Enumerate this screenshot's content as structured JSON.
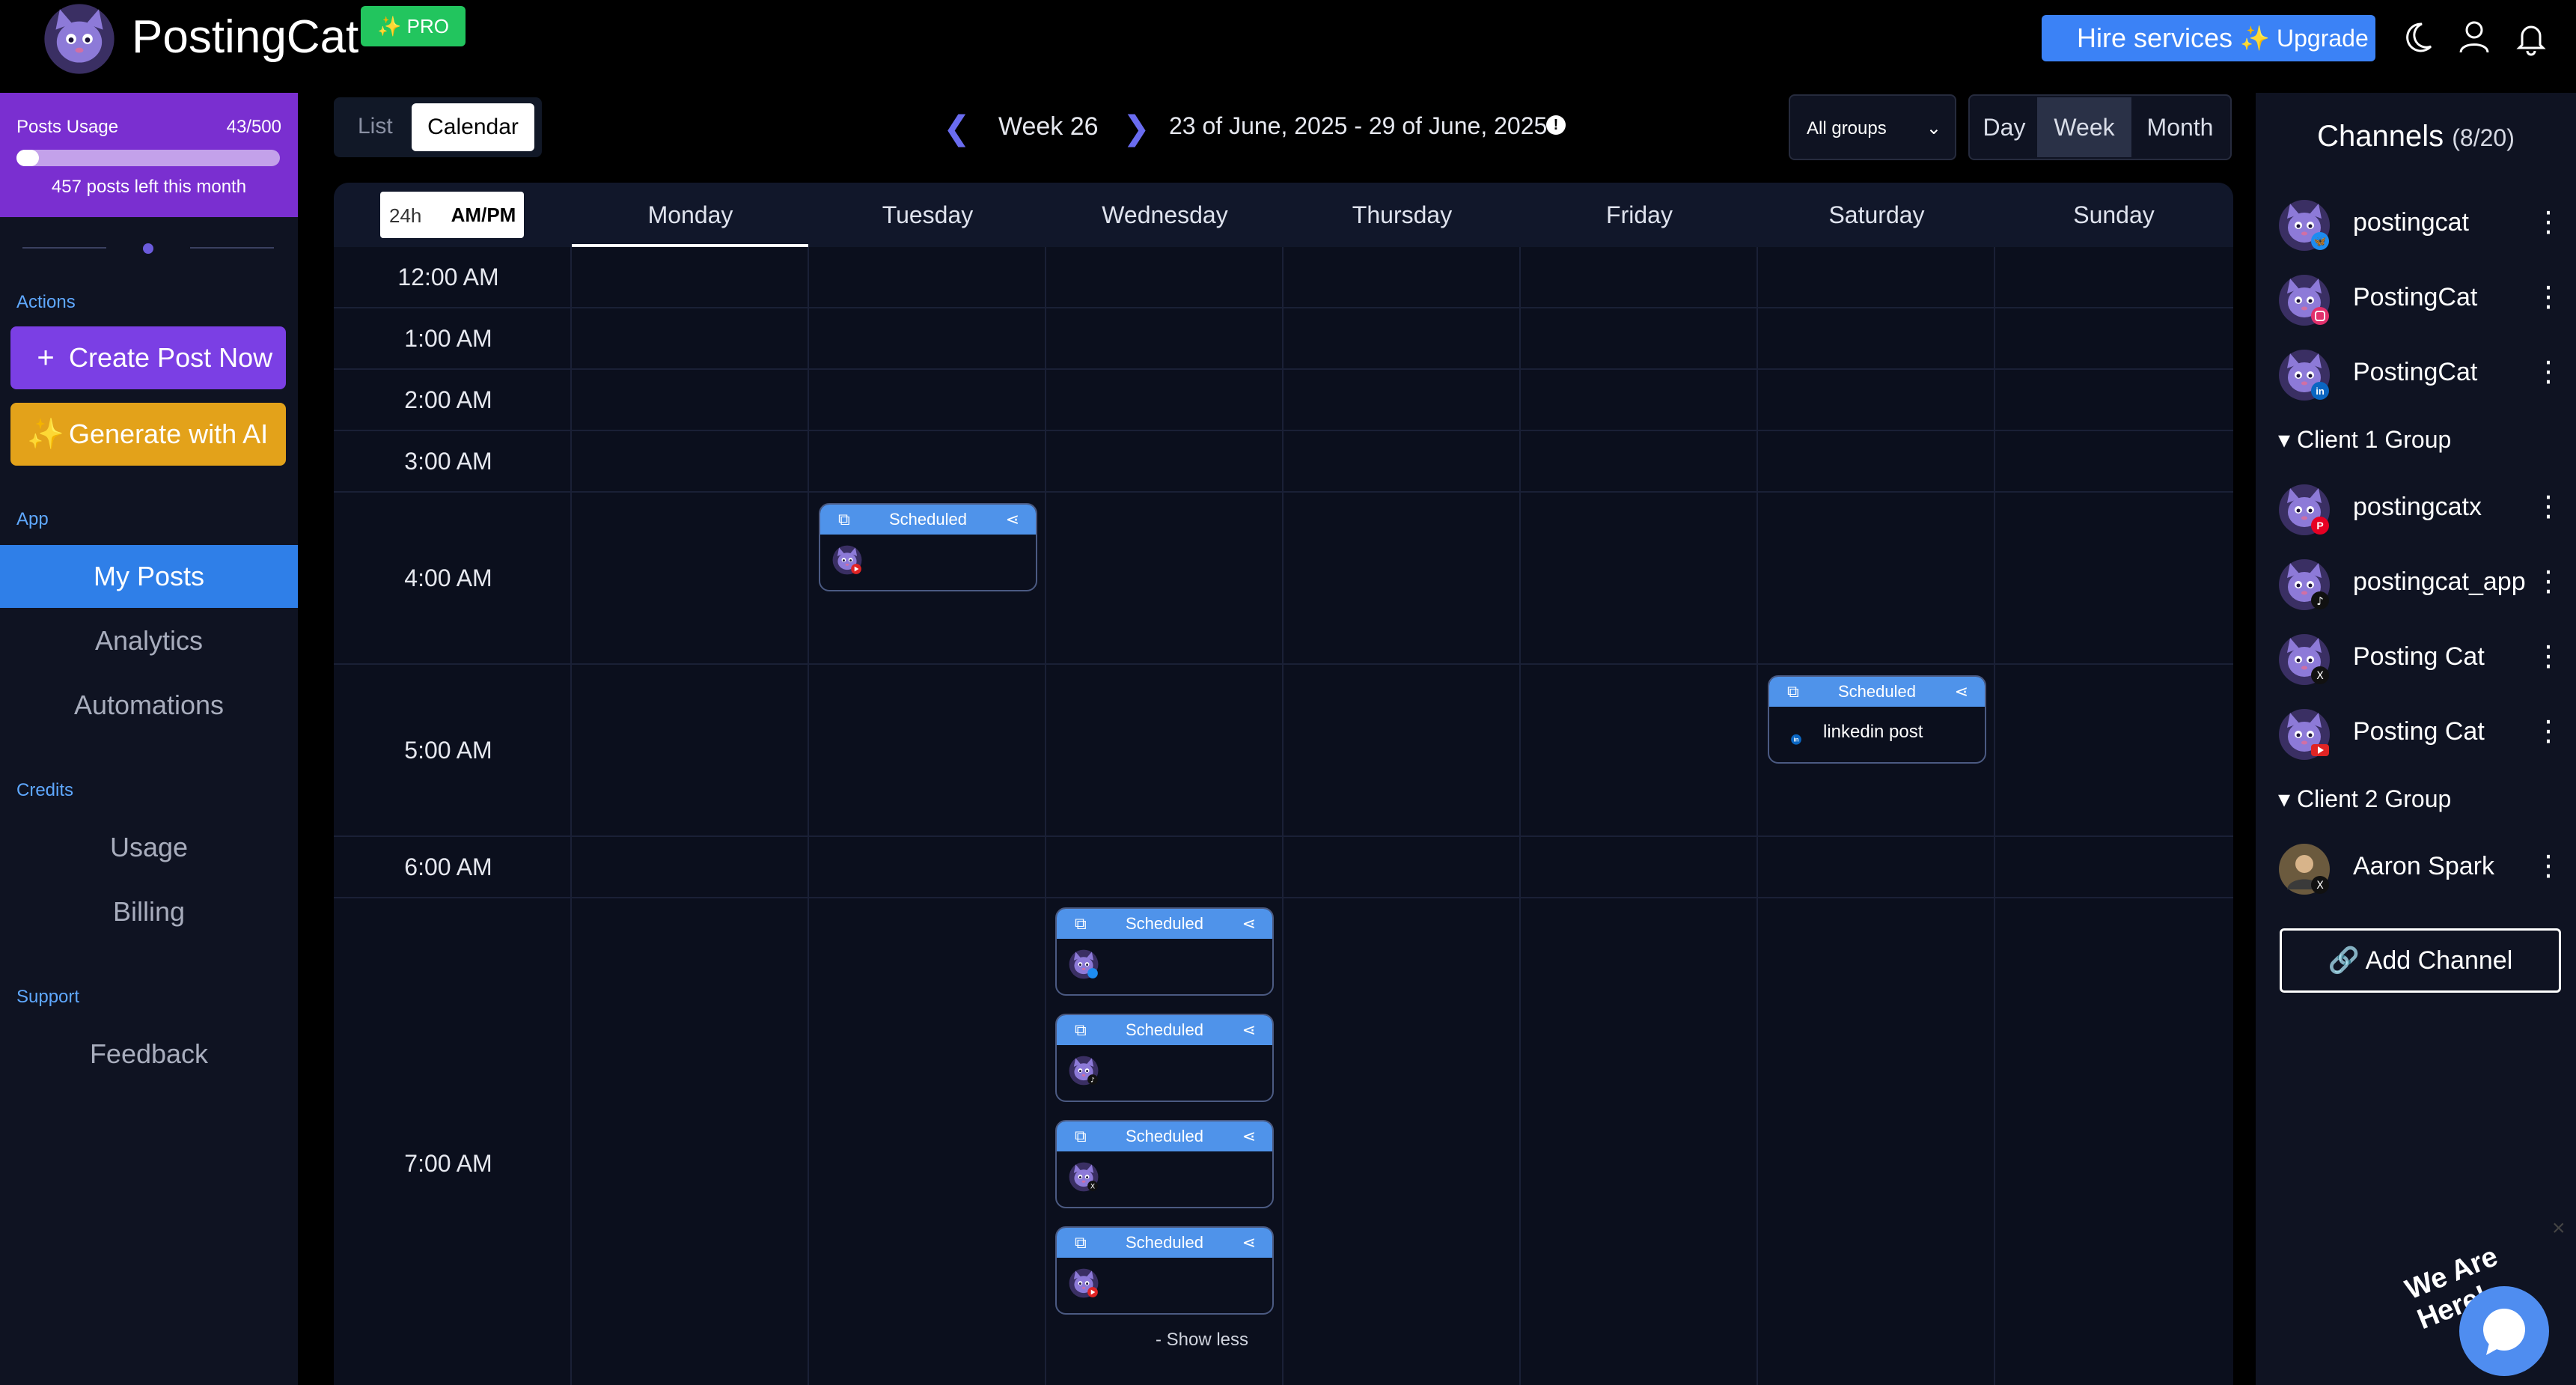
{
  "app": {
    "name": "PostingCat",
    "badge": "✨ PRO"
  },
  "header": {
    "hire_label": "Hire services",
    "upgrade_label": "✨ Upgrade"
  },
  "usage": {
    "title": "Posts Usage",
    "count": "43/500",
    "fraction": 0.086,
    "left_text": "457 posts left this month"
  },
  "sidebar": {
    "actions_label": "Actions",
    "create_label": "Create Post Now",
    "generate_label": "Generate with AI",
    "app_label": "App",
    "app_items": [
      "My Posts",
      "Analytics",
      "Automations"
    ],
    "credits_label": "Credits",
    "credit_items": [
      "Usage",
      "Billing"
    ],
    "support_label": "Support",
    "support_items": [
      "Feedback"
    ]
  },
  "toolbar": {
    "list_label": "List",
    "calendar_label": "Calendar",
    "week_label": "Week 26",
    "range": "23 of June, 2025 - 29 of June, 2025",
    "groups_value": "All groups",
    "views": [
      "Day",
      "Week",
      "Month"
    ],
    "active_view": "Week"
  },
  "calendar": {
    "format_24": "24h",
    "format_ampm": "AM/PM",
    "days": [
      "Monday",
      "Tuesday",
      "Wednesday",
      "Thursday",
      "Friday",
      "Saturday",
      "Sunday"
    ],
    "active_day": "Monday",
    "times": [
      "12:00 AM",
      "1:00 AM",
      "2:00 AM",
      "3:00 AM",
      "4:00 AM",
      "5:00 AM",
      "6:00 AM",
      "7:00 AM"
    ],
    "status_label": "Scheduled",
    "sat_post_text": "linkedin post",
    "show_less": "- Show less"
  },
  "channels": {
    "title": "Channels",
    "count": "(8/20)",
    "items": [
      {
        "name": "postingcat",
        "network": "bluesky"
      },
      {
        "name": "PostingCat",
        "network": "instagram"
      },
      {
        "name": "PostingCat",
        "network": "linkedin"
      },
      {
        "name": "postingcatx",
        "network": "pinterest"
      },
      {
        "name": "postingcat_app",
        "network": "tiktok"
      },
      {
        "name": "Posting Cat",
        "network": "x"
      },
      {
        "name": "Posting Cat",
        "network": "youtube"
      },
      {
        "name": "Aaron Spark",
        "network": "x"
      }
    ],
    "groups": [
      "Client 1 Group",
      "Client 2 Group"
    ],
    "add_label": "Add Channel"
  },
  "chat": {
    "text": "We Are Here!"
  },
  "colors": {
    "accent": "#7b3fe4",
    "primary": "#3b82f6",
    "active_nav": "#2f7fe8",
    "gold": "#e3a21a",
    "scheduled": "#4f93ea"
  }
}
